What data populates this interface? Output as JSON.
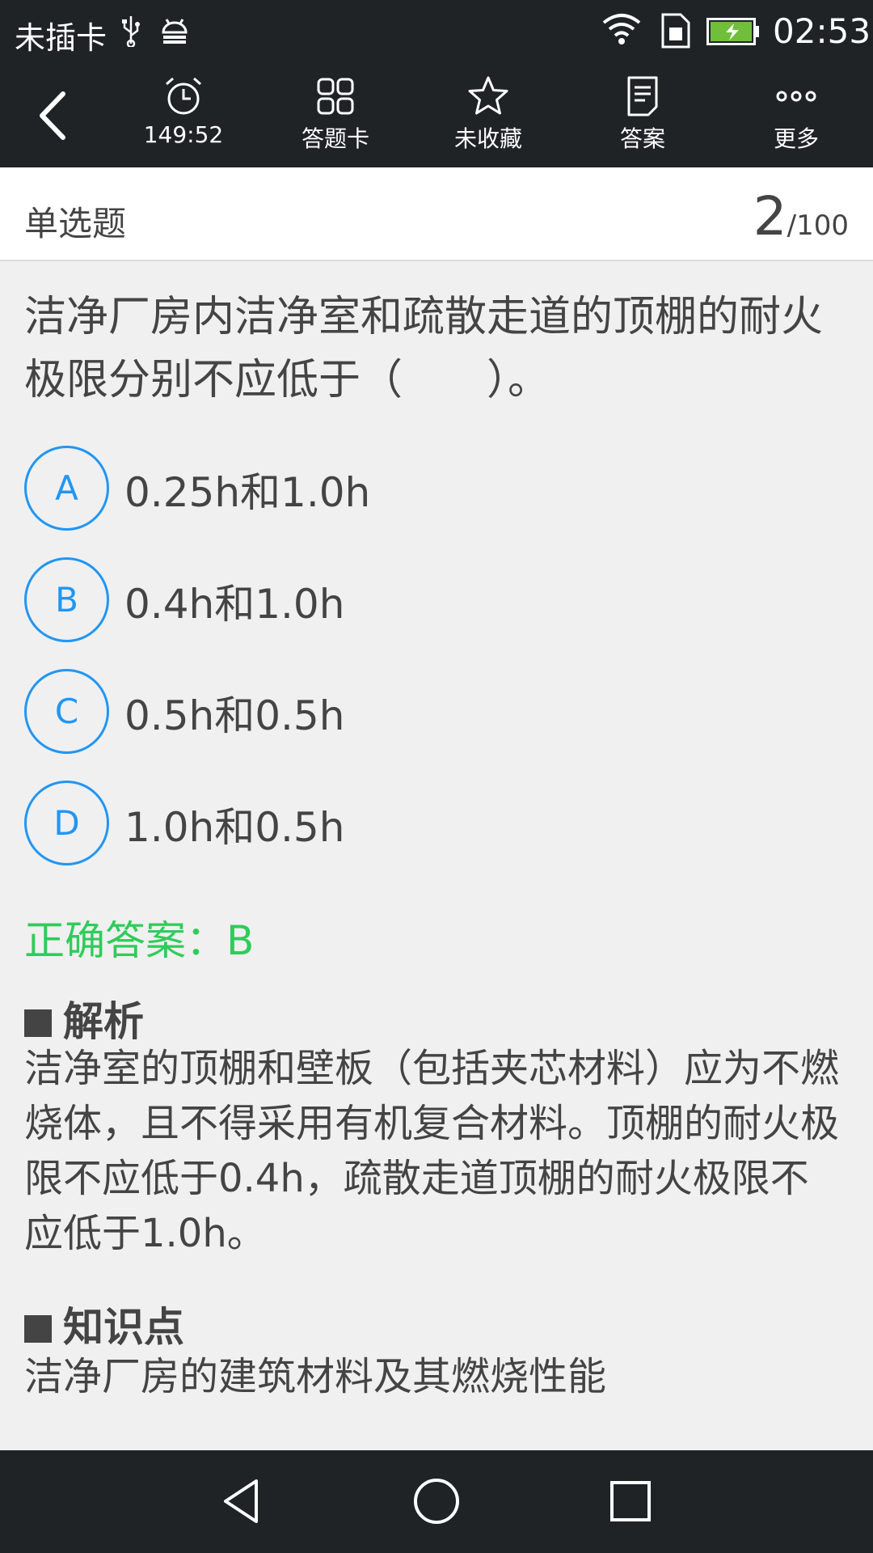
{
  "status_bar": {
    "carrier": "未插卡",
    "time": "02:53",
    "icons": [
      "usb-icon",
      "android-debug-icon",
      "wifi-icon",
      "sim-icon",
      "battery-charging-icon"
    ]
  },
  "toolbar": {
    "back_icon": "chevron-left-icon",
    "items": [
      {
        "label": "149:52",
        "icon": "alarm-clock-icon"
      },
      {
        "label": "答题卡",
        "icon": "grid-icon"
      },
      {
        "label": "未收藏",
        "icon": "star-outline-icon"
      },
      {
        "label": "答案",
        "icon": "document-icon"
      },
      {
        "label": "更多",
        "icon": "more-dots-icon"
      }
    ]
  },
  "question_header": {
    "type": "单选题",
    "current": "2",
    "total": "/100"
  },
  "question": {
    "text": "洁净厂房内洁净室和疏散走道的顶棚的耐火极限分别不应低于（　　）。",
    "options": [
      {
        "letter": "A",
        "text": "0.25h和1.0h"
      },
      {
        "letter": "B",
        "text": "0.4h和1.0h"
      },
      {
        "letter": "C",
        "text": "0.5h和0.5h"
      },
      {
        "letter": "D",
        "text": "1.0h和0.5h"
      }
    ],
    "correct_answer": "正确答案：B"
  },
  "analysis": {
    "title": "解析",
    "body": "洁净室的顶棚和壁板（包括夹芯材料）应为不燃烧体，且不得采用有机复合材料。顶棚的耐火极限不应低于0.4h，疏散走道顶棚的耐火极限不应低于1.0h。"
  },
  "knowledge": {
    "title": "知识点",
    "body": "洁净厂房的建筑材料及其燃烧性能"
  },
  "colors": {
    "bar_bg": "#1f2326",
    "accent_blue": "#2196f3",
    "answer_green": "#2ecc5a",
    "content_bg": "#f0f0f0"
  }
}
